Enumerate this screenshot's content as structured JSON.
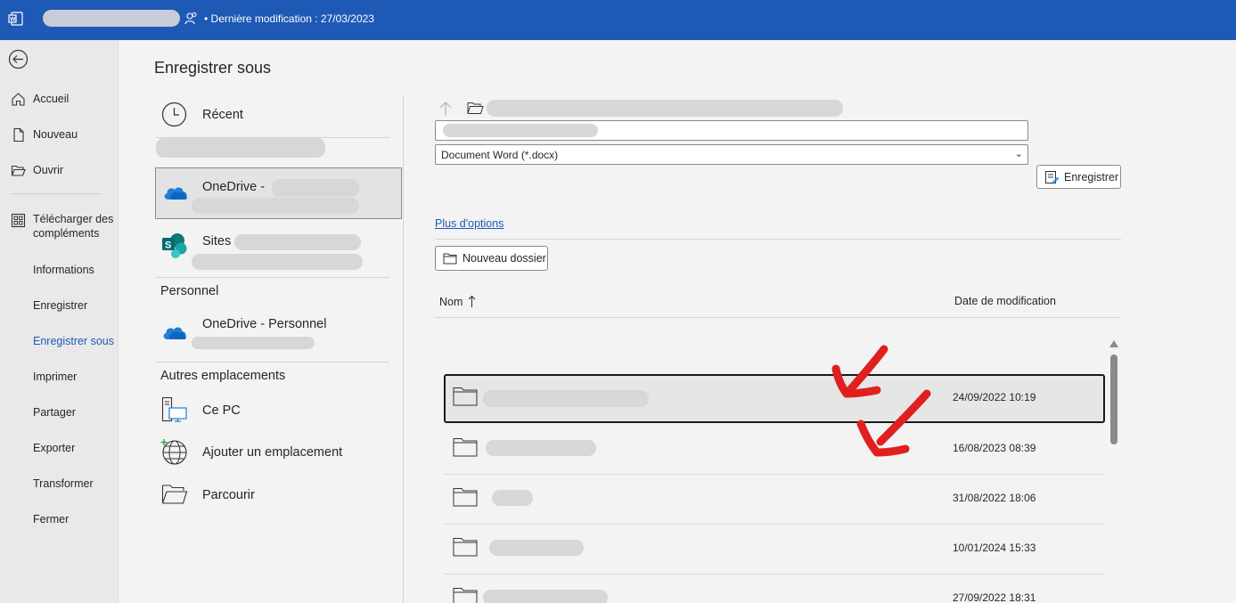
{
  "titlebar": {
    "modified": "• Dernière modification : 27/03/2023"
  },
  "nav": {
    "items": [
      {
        "label": "Accueil",
        "icon": "home-icon"
      },
      {
        "label": "Nouveau",
        "icon": "new-document-icon"
      },
      {
        "label": "Ouvrir",
        "icon": "open-folder-icon"
      },
      {
        "label": "Télécharger des compléments",
        "icon": "addins-icon"
      },
      {
        "label": "Informations"
      },
      {
        "label": "Enregistrer"
      },
      {
        "label": "Enregistrer sous",
        "active": true
      },
      {
        "label": "Imprimer"
      },
      {
        "label": "Partager"
      },
      {
        "label": "Exporter"
      },
      {
        "label": "Transformer"
      },
      {
        "label": "Fermer"
      }
    ]
  },
  "page": {
    "title": "Enregistrer sous"
  },
  "locations": {
    "recent": "Récent",
    "onedrive_org": "OneDrive -",
    "sites": "Sites -",
    "personal_header": "Personnel",
    "onedrive_personal": "OneDrive - Personnel",
    "other_header": "Autres emplacements",
    "this_pc": "Ce PC",
    "add_place": "Ajouter un emplacement",
    "browse": "Parcourir"
  },
  "save_panel": {
    "filetype": "Document Word (*.docx)",
    "save_label": "Enregistrer",
    "more_options": "Plus d'options",
    "new_folder": "Nouveau dossier",
    "col_name": "Nom",
    "col_date": "Date de modification",
    "rows": [
      {
        "date": "24/09/2022 10:19",
        "selected": true
      },
      {
        "date": "16/08/2023 08:39"
      },
      {
        "date": "31/08/2022 18:06"
      },
      {
        "date": "10/01/2024 15:33"
      },
      {
        "date": "27/09/2022 18:31"
      }
    ]
  },
  "colors": {
    "titlebar": "#1e59b5",
    "accent": "#1e59b5",
    "annotation": "#e0201e"
  }
}
